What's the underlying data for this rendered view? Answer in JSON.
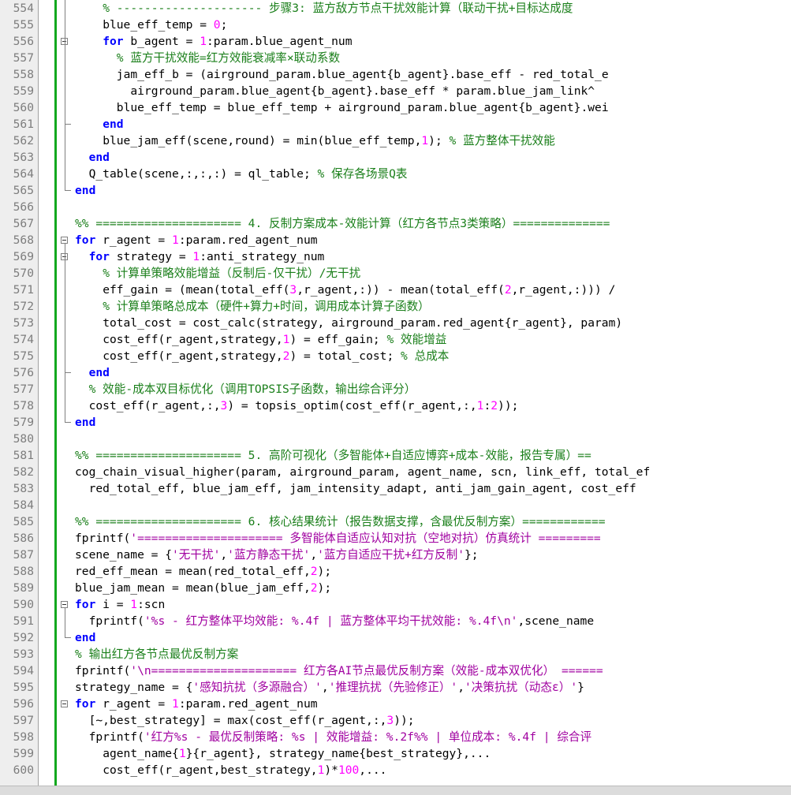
{
  "editor": {
    "language": "MATLAB",
    "colors": {
      "keyword": "#0000ff",
      "number": "#ff00ff",
      "comment": "#1a7f1a",
      "string": "#a000a0",
      "gutter_bg": "#eeeeee",
      "change_bar": "#12a81e"
    },
    "lines": [
      {
        "num": "554",
        "indent": 4,
        "tokens": [
          [
            "c",
            "% --------------------- 步骤3: 蓝方敌方节点干扰效能计算（联动干扰+目标达成度"
          ]
        ]
      },
      {
        "num": "555",
        "indent": 4,
        "tokens": [
          [
            "t",
            "blue_eff_temp = "
          ],
          [
            "n",
            "0"
          ],
          [
            "t",
            ";"
          ]
        ]
      },
      {
        "num": "556",
        "indent": 4,
        "fold": "start",
        "tokens": [
          [
            "k",
            "for"
          ],
          [
            "t",
            " b_agent = "
          ],
          [
            "n",
            "1"
          ],
          [
            "t",
            ":param.blue_agent_num"
          ]
        ]
      },
      {
        "num": "557",
        "indent": 6,
        "tokens": [
          [
            "c",
            "% 蓝方干扰效能=红方效能衰减率×联动系数"
          ]
        ]
      },
      {
        "num": "558",
        "indent": 6,
        "tokens": [
          [
            "t",
            "jam_eff_b = (airground_param.blue_agent{b_agent}.base_eff - red_total_e"
          ]
        ]
      },
      {
        "num": "559",
        "indent": 8,
        "tokens": [
          [
            "t",
            "airground_param.blue_agent{b_agent}.base_eff * param.blue_jam_link^"
          ]
        ]
      },
      {
        "num": "560",
        "indent": 6,
        "tokens": [
          [
            "t",
            "blue_eff_temp = blue_eff_temp + airground_param.blue_agent{b_agent}.wei"
          ]
        ]
      },
      {
        "num": "561",
        "indent": 4,
        "fold": "end",
        "tokens": [
          [
            "k",
            "end"
          ]
        ]
      },
      {
        "num": "562",
        "indent": 4,
        "tokens": [
          [
            "t",
            "blue_jam_eff(scene,round) = min(blue_eff_temp,"
          ],
          [
            "n",
            "1"
          ],
          [
            "t",
            "); "
          ],
          [
            "c",
            "% 蓝方整体干扰效能"
          ]
        ]
      },
      {
        "num": "563",
        "indent": 2,
        "tokens": [
          [
            "k",
            "end"
          ]
        ]
      },
      {
        "num": "564",
        "indent": 2,
        "tokens": [
          [
            "t",
            "Q_table(scene,:,:,:) = ql_table; "
          ],
          [
            "c",
            "% 保存各场景Q表"
          ]
        ]
      },
      {
        "num": "565",
        "indent": 0,
        "fold": "end",
        "tokens": [
          [
            "k",
            "end"
          ]
        ]
      },
      {
        "num": "566",
        "indent": 0,
        "tokens": []
      },
      {
        "num": "567",
        "indent": 0,
        "tokens": [
          [
            "c",
            "%% ===================== 4. 反制方案成本-效能计算（红方各节点3类策略）=============="
          ]
        ]
      },
      {
        "num": "568",
        "indent": 0,
        "fold": "start",
        "tokens": [
          [
            "k",
            "for"
          ],
          [
            "t",
            " r_agent = "
          ],
          [
            "n",
            "1"
          ],
          [
            "t",
            ":param.red_agent_num"
          ]
        ]
      },
      {
        "num": "569",
        "indent": 2,
        "fold": "start",
        "tokens": [
          [
            "k",
            "for"
          ],
          [
            "t",
            " strategy = "
          ],
          [
            "n",
            "1"
          ],
          [
            "t",
            ":anti_strategy_num"
          ]
        ]
      },
      {
        "num": "570",
        "indent": 4,
        "tokens": [
          [
            "c",
            "% 计算单策略效能增益（反制后-仅干扰）/无干扰"
          ]
        ]
      },
      {
        "num": "571",
        "indent": 4,
        "tokens": [
          [
            "t",
            "eff_gain = (mean(total_eff("
          ],
          [
            "n",
            "3"
          ],
          [
            "t",
            ",r_agent,:)) - mean(total_eff("
          ],
          [
            "n",
            "2"
          ],
          [
            "t",
            ",r_agent,:))) /"
          ]
        ]
      },
      {
        "num": "572",
        "indent": 4,
        "tokens": [
          [
            "c",
            "% 计算单策略总成本（硬件+算力+时间，调用成本计算子函数）"
          ]
        ]
      },
      {
        "num": "573",
        "indent": 4,
        "tokens": [
          [
            "t",
            "total_cost = cost_calc(strategy, airground_param.red_agent{r_agent}, param)"
          ]
        ]
      },
      {
        "num": "574",
        "indent": 4,
        "tokens": [
          [
            "t",
            "cost_eff(r_agent,strategy,"
          ],
          [
            "n",
            "1"
          ],
          [
            "t",
            ") = eff_gain; "
          ],
          [
            "c",
            "% 效能增益"
          ]
        ]
      },
      {
        "num": "575",
        "indent": 4,
        "tokens": [
          [
            "t",
            "cost_eff(r_agent,strategy,"
          ],
          [
            "n",
            "2"
          ],
          [
            "t",
            ") = total_cost; "
          ],
          [
            "c",
            "% 总成本"
          ]
        ]
      },
      {
        "num": "576",
        "indent": 2,
        "fold": "end",
        "tokens": [
          [
            "k",
            "end"
          ]
        ]
      },
      {
        "num": "577",
        "indent": 2,
        "tokens": [
          [
            "c",
            "% 效能-成本双目标优化（调用TOPSIS子函数，输出综合评分）"
          ]
        ]
      },
      {
        "num": "578",
        "indent": 2,
        "tokens": [
          [
            "t",
            "cost_eff(r_agent,:,"
          ],
          [
            "n",
            "3"
          ],
          [
            "t",
            ") = topsis_optim(cost_eff(r_agent,:,"
          ],
          [
            "n",
            "1"
          ],
          [
            "t",
            ":"
          ],
          [
            "n",
            "2"
          ],
          [
            "t",
            "));"
          ]
        ]
      },
      {
        "num": "579",
        "indent": 0,
        "fold": "end",
        "tokens": [
          [
            "k",
            "end"
          ]
        ]
      },
      {
        "num": "580",
        "indent": 0,
        "tokens": []
      },
      {
        "num": "581",
        "indent": 0,
        "tokens": [
          [
            "c",
            "%% ===================== 5. 高阶可视化（多智能体+自适应博弈+成本-效能，报告专属）=="
          ]
        ]
      },
      {
        "num": "582",
        "indent": 0,
        "tokens": [
          [
            "t",
            "cog_chain_visual_higher(param, airground_param, agent_name, scn, link_eff, total_ef"
          ]
        ]
      },
      {
        "num": "583",
        "indent": 2,
        "tokens": [
          [
            "t",
            "red_total_eff, blue_jam_eff, jam_intensity_adapt, anti_jam_gain_agent, cost_eff"
          ]
        ]
      },
      {
        "num": "584",
        "indent": 0,
        "tokens": []
      },
      {
        "num": "585",
        "indent": 0,
        "tokens": [
          [
            "c",
            "%% ===================== 6. 核心结果统计（报告数据支撑，含最优反制方案）============"
          ]
        ]
      },
      {
        "num": "586",
        "indent": 0,
        "tokens": [
          [
            "t",
            "fprintf("
          ],
          [
            "s",
            "'===================== 多智能体自适应认知对抗（空地对抗）仿真统计 ========="
          ]
        ]
      },
      {
        "num": "587",
        "indent": 0,
        "tokens": [
          [
            "t",
            "scene_name = {"
          ],
          [
            "s",
            "'无干扰'"
          ],
          [
            "t",
            ","
          ],
          [
            "s",
            "'蓝方静态干扰'"
          ],
          [
            "t",
            ","
          ],
          [
            "s",
            "'蓝方自适应干扰+红方反制'"
          ],
          [
            "t",
            "};"
          ]
        ]
      },
      {
        "num": "588",
        "indent": 0,
        "tokens": [
          [
            "t",
            "red_eff_mean = mean(red_total_eff,"
          ],
          [
            "n",
            "2"
          ],
          [
            "t",
            ");"
          ]
        ]
      },
      {
        "num": "589",
        "indent": 0,
        "tokens": [
          [
            "t",
            "blue_jam_mean = mean(blue_jam_eff,"
          ],
          [
            "n",
            "2"
          ],
          [
            "t",
            ");"
          ]
        ]
      },
      {
        "num": "590",
        "indent": 0,
        "fold": "start",
        "tokens": [
          [
            "k",
            "for"
          ],
          [
            "t",
            " i = "
          ],
          [
            "n",
            "1"
          ],
          [
            "t",
            ":scn"
          ]
        ]
      },
      {
        "num": "591",
        "indent": 2,
        "tokens": [
          [
            "t",
            "fprintf("
          ],
          [
            "s",
            "'%s - 红方整体平均效能: %.4f | 蓝方整体平均干扰效能: %.4f\\n'"
          ],
          [
            "t",
            ",scene_name"
          ]
        ]
      },
      {
        "num": "592",
        "indent": 0,
        "fold": "end",
        "tokens": [
          [
            "k",
            "end"
          ]
        ]
      },
      {
        "num": "593",
        "indent": 0,
        "tokens": [
          [
            "c",
            "% 输出红方各节点最优反制方案"
          ]
        ]
      },
      {
        "num": "594",
        "indent": 0,
        "tokens": [
          [
            "t",
            "fprintf("
          ],
          [
            "s",
            "'\\n===================== 红方各AI节点最优反制方案（效能-成本双优化） ======"
          ]
        ]
      },
      {
        "num": "595",
        "indent": 0,
        "tokens": [
          [
            "t",
            "strategy_name = {"
          ],
          [
            "s",
            "'感知抗扰（多源融合）'"
          ],
          [
            "t",
            ","
          ],
          [
            "s",
            "'推理抗扰（先验修正）'"
          ],
          [
            "t",
            ","
          ],
          [
            "s",
            "'决策抗扰（动态ε）'"
          ],
          [
            "t",
            "}"
          ]
        ]
      },
      {
        "num": "596",
        "indent": 0,
        "fold": "start",
        "tokens": [
          [
            "k",
            "for"
          ],
          [
            "t",
            " r_agent = "
          ],
          [
            "n",
            "1"
          ],
          [
            "t",
            ":param.red_agent_num"
          ]
        ]
      },
      {
        "num": "597",
        "indent": 2,
        "tokens": [
          [
            "t",
            "[~,best_strategy] = max(cost_eff(r_agent,:,"
          ],
          [
            "n",
            "3"
          ],
          [
            "t",
            "));"
          ]
        ]
      },
      {
        "num": "598",
        "indent": 2,
        "tokens": [
          [
            "t",
            "fprintf("
          ],
          [
            "s",
            "'红方%s - 最优反制策略: %s | 效能增益: %.2f%% | 单位成本: %.4f | 综合评"
          ]
        ]
      },
      {
        "num": "599",
        "indent": 4,
        "tokens": [
          [
            "t",
            "agent_name{"
          ],
          [
            "n",
            "1"
          ],
          [
            "t",
            "}{r_agent}, strategy_name{best_strategy},..."
          ]
        ]
      },
      {
        "num": "600",
        "indent": 4,
        "tokens": [
          [
            "t",
            "cost_eff(r_agent,best_strategy,"
          ],
          [
            "n",
            "1"
          ],
          [
            "t",
            ")*"
          ],
          [
            "n",
            "100"
          ],
          [
            "t",
            ",..."
          ]
        ]
      }
    ]
  }
}
